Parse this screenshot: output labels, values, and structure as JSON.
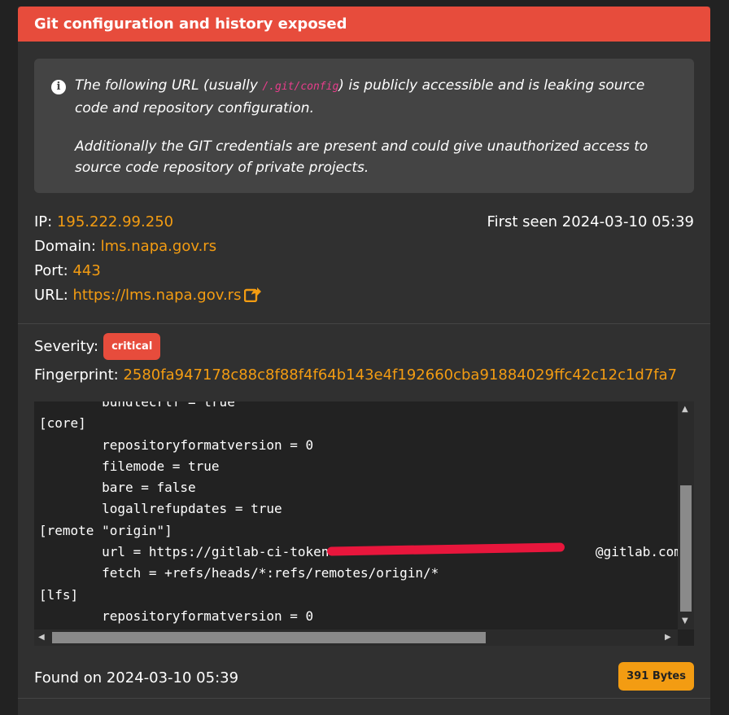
{
  "card": {
    "title": "Git configuration and history exposed",
    "alert": {
      "line1_pre": "The following URL (usually ",
      "line1_code": "/.git/config",
      "line1_post": ") is publicly accessible and is leaking source code and repository configuration.",
      "line2": "Additionally the GIT credentials are present and could give unauthorized access to source code repository of private projects."
    },
    "meta": {
      "ip_label": "IP: ",
      "ip": "195.222.99.250",
      "domain_label": "Domain: ",
      "domain": "lms.napa.gov.rs",
      "port_label": "Port: ",
      "port": "443",
      "url_label": "URL: ",
      "url": "https://lms.napa.gov.rs",
      "first_seen": "First seen 2024-03-10 05:39"
    },
    "severity_label": "Severity:",
    "severity": "critical",
    "fingerprint_label": "Fingerprint: ",
    "fingerprint": "2580fa947178c88c8f88f4f64b143e4f192660cba91884029ffc42c12c1d7fa7",
    "code_lines": [
      "        bundlecrlf = true",
      "[core]",
      "        repositoryformatversion = 0",
      "        filemode = true",
      "        bare = false",
      "        logallrefupdates = true",
      "[remote \"origin\"]",
      "        url = https://gitlab-ci-token                                  @gitlab.com/sir",
      "        fetch = +refs/heads/*:refs/remotes/origin/*",
      "[lfs]",
      "        repositoryformatversion = 0"
    ],
    "found_on": "Found on 2024-03-10 05:39",
    "size": "391 Bytes"
  }
}
